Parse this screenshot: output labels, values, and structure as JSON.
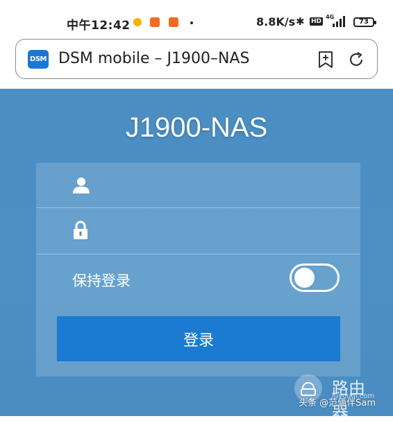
{
  "status_bar": {
    "time": "中午12:42",
    "network_speed": "8.8K/s",
    "bluetooth_glyph": "✱",
    "hd_label": "HD",
    "signal_label": "4G",
    "battery": "73",
    "icons": [
      "app-notification-icon",
      "app-notification-icon",
      "app-notification-icon",
      "dot-icon",
      "bluetooth-icon",
      "hd-icon",
      "signal-icon",
      "battery-icon"
    ]
  },
  "browser": {
    "site_logo": "DSM",
    "title": "DSM mobile – J1900–NAS",
    "icons": [
      "bookmark-add-icon",
      "reload-icon"
    ]
  },
  "login": {
    "nas_name": "J1900-NAS",
    "username": {
      "value": "",
      "placeholder": "",
      "icon": "user-icon"
    },
    "password": {
      "value": "",
      "placeholder": "",
      "icon": "lock-icon"
    },
    "remember_label": "保持登录",
    "remember_enabled": false,
    "submit_label": "登录"
  },
  "colors": {
    "page_background": "#4b8ec3",
    "button": "#1b7ad1",
    "logo": "#1a77d2"
  },
  "watermark": {
    "router_text": "路由器",
    "site_text": "luyouqi.com",
    "author_text": "头条 @范俩伴Sam"
  }
}
